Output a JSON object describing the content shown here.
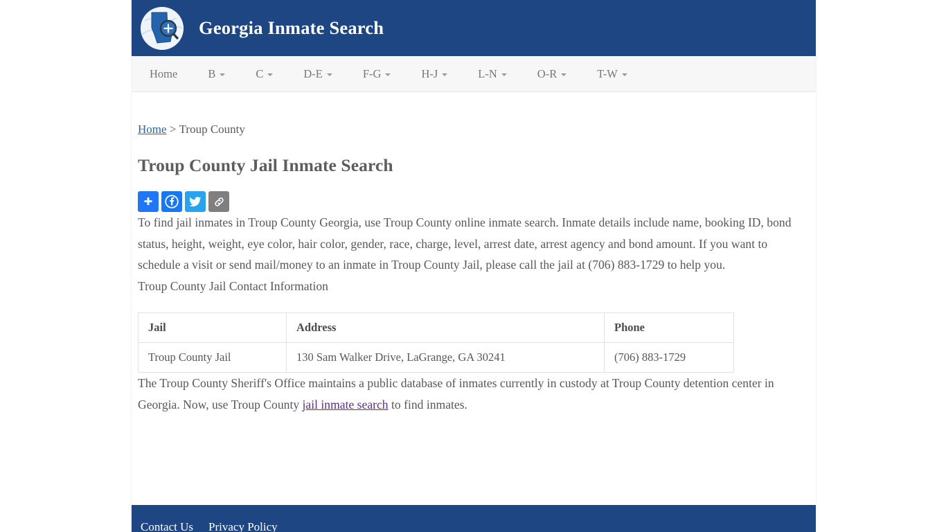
{
  "header": {
    "logo_icon": "georgia-map-magnifier-icon",
    "title": "Georgia Inmate Search"
  },
  "nav": {
    "items": [
      {
        "label": "Home",
        "has_dropdown": false
      },
      {
        "label": "B",
        "has_dropdown": true
      },
      {
        "label": "C",
        "has_dropdown": true
      },
      {
        "label": "D-E",
        "has_dropdown": true
      },
      {
        "label": "F-G",
        "has_dropdown": true
      },
      {
        "label": "H-J",
        "has_dropdown": true
      },
      {
        "label": "L-N",
        "has_dropdown": true
      },
      {
        "label": "O-R",
        "has_dropdown": true
      },
      {
        "label": "T-W",
        "has_dropdown": true
      }
    ]
  },
  "breadcrumb": {
    "home_label": "Home",
    "separator": ">",
    "current": "Troup County"
  },
  "page_title": "Troup County Jail Inmate Search",
  "share": {
    "buttons": [
      {
        "name": "addthis",
        "icon": "plus-icon",
        "label": "Share"
      },
      {
        "name": "facebook",
        "icon": "facebook-icon",
        "label": "Facebook"
      },
      {
        "name": "twitter",
        "icon": "twitter-icon",
        "label": "Twitter"
      },
      {
        "name": "copylink",
        "icon": "link-icon",
        "label": "Copy Link"
      }
    ]
  },
  "content": {
    "paragraph_1": "To find jail inmates in Troup County Georgia, use Troup County online inmate search. Inmate details include name, booking ID, bond status, height, weight, eye color, hair color, gender, race, charge, level, arrest date, arrest agency and bond amount. If you want to schedule a visit or send mail/money to an inmate in Troup County Jail, please call the jail at (706) 883-1729 to help you.",
    "contact_heading": "Troup County Jail Contact Information",
    "last_paragraph_before_link": "The Troup County Sheriff's Office maintains a public database of inmates currently in custody at Troup County detention center in Georgia. Now, use Troup County ",
    "last_paragraph_link": "jail inmate search",
    "last_paragraph_after_link": " to find inmates."
  },
  "table": {
    "headers": [
      "Jail",
      "Address",
      "Phone"
    ],
    "rows": [
      [
        "Troup County Jail",
        "130 Sam Walker Drive, LaGrange, GA 30241",
        "(706) 883-1729"
      ]
    ]
  },
  "footer": {
    "links": [
      {
        "label": "Contact Us"
      },
      {
        "label": "Privacy Policy"
      }
    ]
  },
  "colors": {
    "brand_blue": "#1d4682",
    "nav_bg": "#f7f7f7",
    "text": "#55585c",
    "link": "#31658f",
    "visited_link": "#5b2d8e",
    "facebook": "#1877f2",
    "twitter": "#2aa3ef",
    "addthis": "#2176f6",
    "copylink": "#7f7f7f",
    "table_border": "#e2e2e2"
  }
}
